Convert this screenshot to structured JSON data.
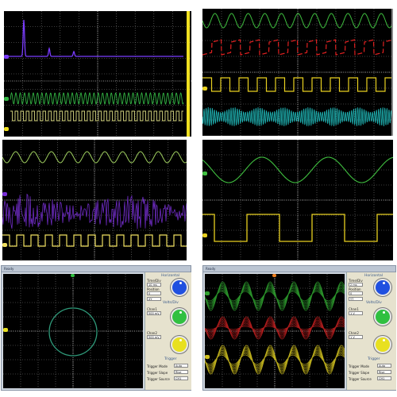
{
  "panels": {
    "spectrum": {
      "colors": {
        "spectrum": "#7a3cff",
        "green": "#33b544",
        "yellow": "#d8d880"
      }
    },
    "four_channel": {
      "colors": {
        "green": "#3fbf3f",
        "red": "#e02020",
        "yellow": "#e8d020",
        "cyan": "#20b8b8"
      }
    },
    "noise": {
      "colors": {
        "green": "#a0d060",
        "purple": "#7a30d8",
        "yellow": "#f0e060"
      }
    },
    "sine_square": {
      "colors": {
        "green": "#40c040",
        "yellow": "#e8d020"
      }
    },
    "lissajous": {
      "title": "Ready",
      "controls": {
        "horizontal_label": "Horizontal",
        "time_div_label": "Time/Div",
        "position_label": "Position",
        "time_div_value": "10 ms",
        "position_value": "0",
        "mode_value": "XY",
        "volts_div_label": "Volts/Div",
        "ch1_label": "Chan1",
        "ch1_value": "500 mV",
        "ch2_label": "Chan2",
        "ch2_value": "500 mV",
        "trigger_label": "Trigger",
        "trigger_rows": [
          "Trigger Mode",
          "Trigger Slope",
          "Trigger Source"
        ],
        "trigger_values": [
          "Auto",
          "Rise",
          "CH1"
        ]
      },
      "colors": {
        "circle": "#2f9a7a",
        "knob1": "#2050e0",
        "knob2": "#30c040",
        "knob3": "#e8e020"
      }
    },
    "multi_trace": {
      "title": "Ready",
      "controls": {
        "horizontal_label": "Horizontal",
        "time_div_label": "Time/Div",
        "position_label": "Position",
        "time_div_value": "2 ms",
        "position_value": "0",
        "mode_value": "YT",
        "volts_div_label": "Volts/Div",
        "ch1_label": "Chan1",
        "ch1_value": "1 V",
        "ch2_label": "Chan2",
        "ch2_value": "1 V",
        "trigger_label": "Trigger",
        "trigger_rows": [
          "Trigger Mode",
          "Trigger Slope",
          "Trigger Source"
        ],
        "trigger_values": [
          "Auto",
          "Rise",
          "CH1"
        ]
      },
      "colors": {
        "green": "#2fa02f",
        "red": "#c02020",
        "yellow": "#d0c020",
        "knob1": "#2050e0",
        "knob2": "#30c040",
        "knob3": "#e8e020"
      }
    }
  }
}
